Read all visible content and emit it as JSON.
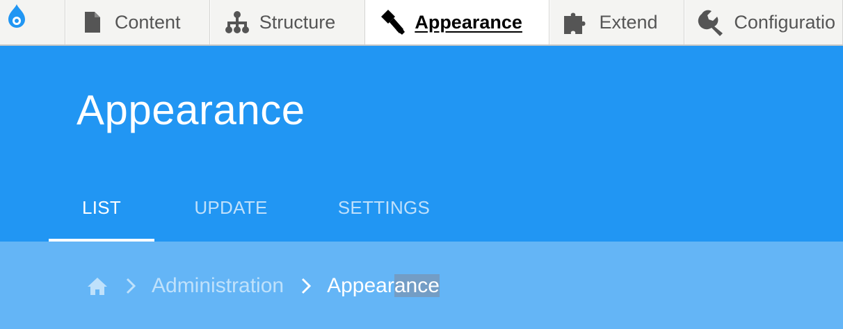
{
  "toolbar": {
    "logo_icon": "drupal-drop-icon",
    "items": [
      {
        "label": "Content",
        "icon": "document-icon"
      },
      {
        "label": "Structure",
        "icon": "sitemap-icon"
      },
      {
        "label": "Appearance",
        "icon": "paintbrush-icon",
        "active": true
      },
      {
        "label": "Extend",
        "icon": "puzzle-icon"
      },
      {
        "label": "Configuratio",
        "icon": "wrench-icon"
      }
    ]
  },
  "header": {
    "title": "Appearance",
    "background_color": "#2196f3"
  },
  "tabs": [
    {
      "label": "LIST",
      "active": true
    },
    {
      "label": "UPDATE",
      "active": false
    },
    {
      "label": "SETTINGS",
      "active": false
    }
  ],
  "breadcrumb": {
    "home_icon": "home-icon",
    "separator_icon": "chevron-right-icon",
    "items": [
      {
        "label": "Administration"
      }
    ],
    "current_part1": "Appear",
    "current_part2": "ance",
    "background_color": "#64b5f6"
  }
}
